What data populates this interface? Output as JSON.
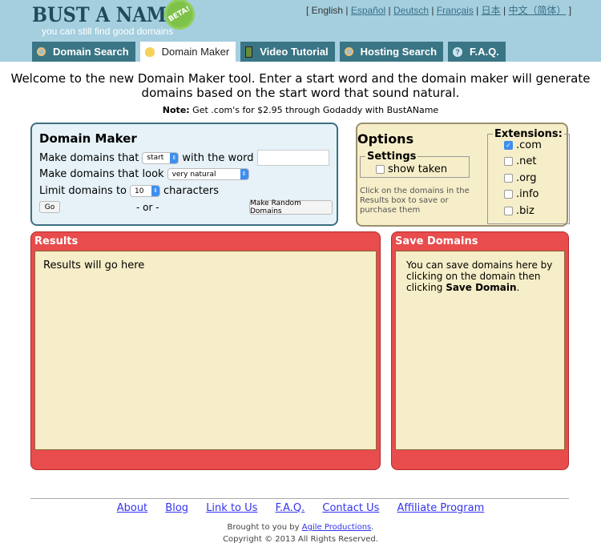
{
  "header": {
    "logo_title": "BUST A NAME",
    "logo_badge": "BETA!",
    "logo_tagline": "you can still find good domains",
    "languages": {
      "current": "English",
      "links": [
        "Español",
        "Deutsch",
        "Français",
        "日本",
        "中文（简体）"
      ]
    }
  },
  "tabs": [
    {
      "label": "Domain Search",
      "icon": "search-icon"
    },
    {
      "label": "Domain Maker",
      "icon": "lightbulb-icon",
      "active": true
    },
    {
      "label": "Video Tutorial",
      "icon": "film-icon"
    },
    {
      "label": "Hosting Search",
      "icon": "search-icon"
    },
    {
      "label": "F.A.Q.",
      "icon": "help-icon"
    }
  ],
  "intro": "Welcome to the new Domain Maker tool. Enter a start word and the domain maker will generate domains based on the start word that sound natural.",
  "note": {
    "label": "Note:",
    "text": " Get .com's for $2.95 through Godaddy with BustAName"
  },
  "domain_maker": {
    "title": "Domain Maker",
    "row1_label": "Make domains that",
    "position_select": "start",
    "row1_suffix": "with the word",
    "word_value": "",
    "row2_label": "Make domains that look",
    "style_select": "very natural",
    "row3_label": "Limit domains to",
    "length_select": "10",
    "row3_suffix": "characters",
    "go_label": "Go",
    "or_label": "- or -",
    "random_label": "Make Random Domains"
  },
  "options": {
    "title": "Options",
    "settings_legend": "Settings",
    "show_taken": "show taken",
    "show_taken_checked": false,
    "hint": "Click on the domains in the Results box to save or purchase them",
    "extensions_legend": "Extensions:",
    "extensions": [
      {
        "label": ".com",
        "checked": true
      },
      {
        "label": ".net",
        "checked": false
      },
      {
        "label": ".org",
        "checked": false
      },
      {
        "label": ".info",
        "checked": false
      },
      {
        "label": ".biz",
        "checked": false
      }
    ]
  },
  "results": {
    "title": "Results",
    "placeholder": "Results will go here"
  },
  "save": {
    "title": "Save Domains",
    "text": "You can save domains here by clicking on the domain then clicking ",
    "bold": "Save Domain",
    "end": "."
  },
  "footer": {
    "links": [
      "About",
      "Blog",
      "Link to Us",
      "F.A.Q.",
      "Contact Us",
      "Affiliate Program"
    ],
    "brought": "Brought to you by ",
    "company": "Agile Productions",
    "period": ".",
    "copyright": "Copyright © 2013 All Rights Reserved."
  },
  "colors": {
    "header_bg": "#a5cfdf",
    "tab_bg": "#3a7585",
    "panel_red": "#e84c4c",
    "beige": "#f6eec8"
  }
}
